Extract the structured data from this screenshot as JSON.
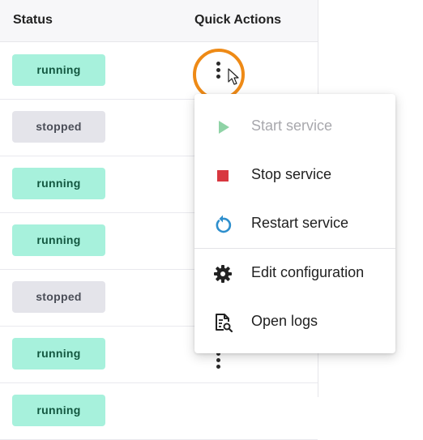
{
  "table": {
    "headers": {
      "status": "Status",
      "quick_actions": "Quick Actions"
    },
    "rows": [
      {
        "status": "running"
      },
      {
        "status": "stopped"
      },
      {
        "status": "running"
      },
      {
        "status": "running"
      },
      {
        "status": "stopped"
      },
      {
        "status": "running"
      },
      {
        "status": "running"
      }
    ]
  },
  "menu": {
    "items": [
      {
        "label": "Start service",
        "icon": "play-icon",
        "disabled": true
      },
      {
        "label": "Stop service",
        "icon": "stop-icon",
        "disabled": false
      },
      {
        "label": "Restart service",
        "icon": "restart-icon",
        "disabled": false
      },
      {
        "label": "Edit configuration",
        "icon": "gear-icon",
        "disabled": false
      },
      {
        "label": "Open logs",
        "icon": "logs-icon",
        "disabled": false
      }
    ]
  },
  "colors": {
    "running_bg": "#a7f1dc",
    "stopped_bg": "#e4e4ea",
    "highlight": "#ee8a16",
    "play": "#8fd3a6",
    "stop": "#d8373f",
    "restart": "#2e8fcd"
  }
}
